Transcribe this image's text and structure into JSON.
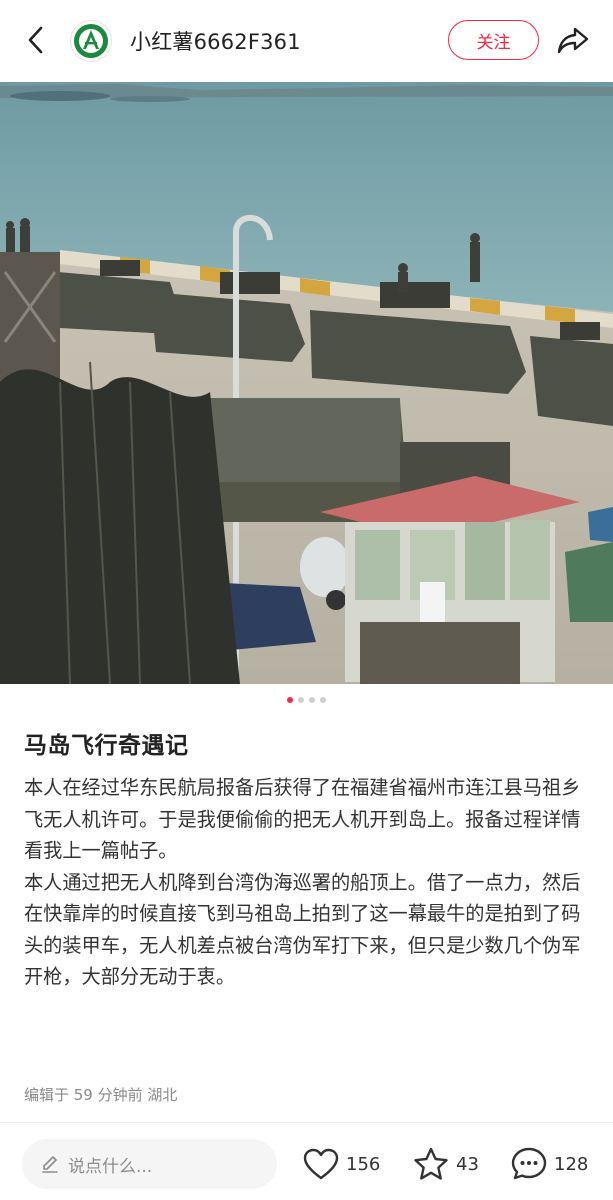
{
  "header": {
    "username": "小红薯6662F361",
    "follow_label": "关注",
    "back_icon": "back-arrow-icon",
    "share_icon": "share-arrow-icon"
  },
  "carousel": {
    "total": 4,
    "active_index": 0,
    "active_color": "#ff2442"
  },
  "post": {
    "title": "马岛飞行奇遇记",
    "paragraphs": [
      "本人在经过华东民航局报备后获得了在福建省福州市连江县马祖乡飞无人机许可。于是我便偷偷的把无人机开到岛上。报备过程详情看我上一篇帖子。",
      "本人通过把无人机降到台湾伪海巡署的船顶上。借了一点力，然后在快靠岸的时候直接飞到马祖岛上拍到了这一幕最牛的是拍到了码头的装甲车，无人机差点被台湾伪军打下来，但只是少数几个伪军开枪，大部分无动于衷。"
    ],
    "meta": "编辑于 59 分钟前  湖北"
  },
  "bottom_bar": {
    "comment_placeholder": "说点什么...",
    "likes": "156",
    "collects": "43",
    "comments": "128"
  },
  "colors": {
    "accent": "#ff2442"
  }
}
